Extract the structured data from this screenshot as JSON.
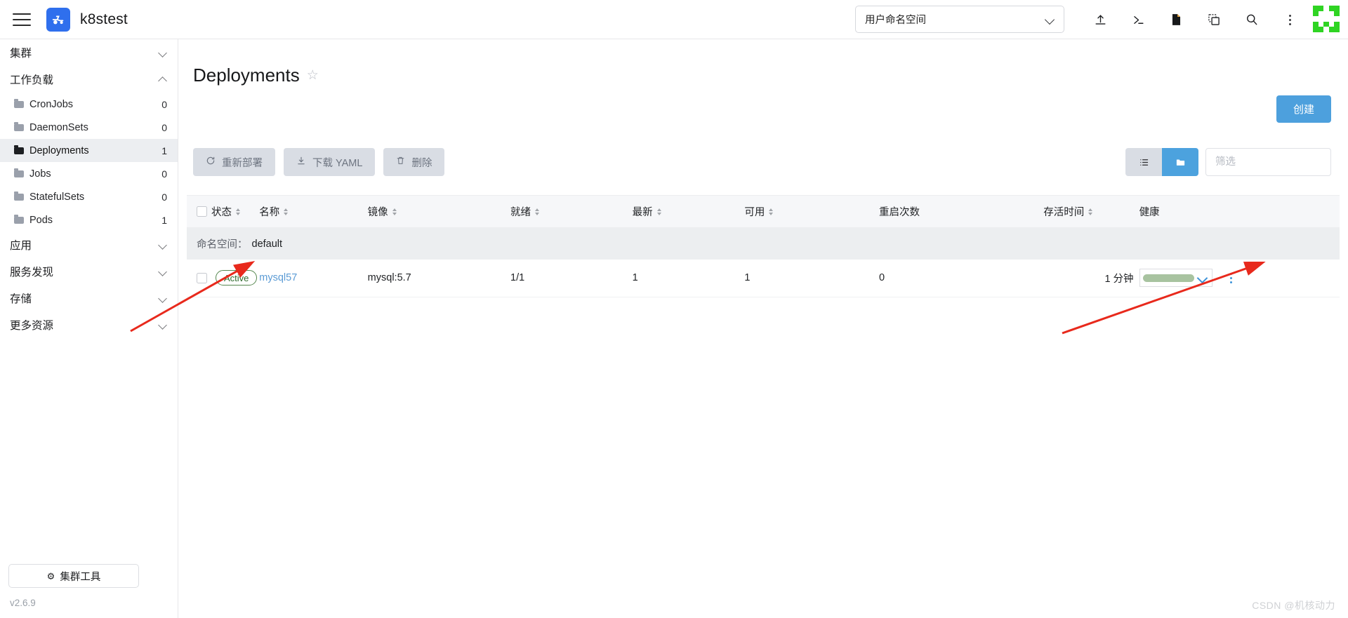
{
  "topbar": {
    "menu_icon": "hamburger-icon",
    "brand_logo_icon": "rancher-logo-icon",
    "brand_name": "k8stest",
    "namespace_selector": {
      "value": "用户命名空间",
      "chevron_icon": "chevron-down-icon"
    },
    "icons": [
      {
        "name": "import-yaml-icon",
        "glyph": "upload"
      },
      {
        "name": "kubectl-shell-icon",
        "glyph": "terminal"
      },
      {
        "name": "kubeconfig-file-icon",
        "glyph": "file"
      },
      {
        "name": "copy-kubeconfig-icon",
        "glyph": "copy"
      },
      {
        "name": "search-icon",
        "glyph": "search"
      },
      {
        "name": "more-options-icon",
        "glyph": "kebab"
      }
    ],
    "product_logo_icon": "kubernetes-green-logo",
    "product_logo_color": "#2fd423"
  },
  "sidebar": {
    "groups": [
      {
        "label": "集群",
        "expanded": false
      },
      {
        "label": "工作负载",
        "expanded": true
      },
      {
        "label": "应用",
        "expanded": false
      },
      {
        "label": "服务发现",
        "expanded": false
      },
      {
        "label": "存储",
        "expanded": false
      },
      {
        "label": "更多资源",
        "expanded": false
      }
    ],
    "workload_items": [
      {
        "label": "CronJobs",
        "count": "0",
        "active": false
      },
      {
        "label": "DaemonSets",
        "count": "0",
        "active": false
      },
      {
        "label": "Deployments",
        "count": "1",
        "active": true
      },
      {
        "label": "Jobs",
        "count": "0",
        "active": false
      },
      {
        "label": "StatefulSets",
        "count": "0",
        "active": false
      },
      {
        "label": "Pods",
        "count": "1",
        "active": false
      }
    ],
    "cluster_tools": {
      "label": "集群工具",
      "icon": "gear-icon"
    },
    "version": "v2.6.9"
  },
  "main": {
    "page_title": "Deployments",
    "favorite_icon": "star-outline-icon",
    "create_button": "创建",
    "create_button_color": "#4da0dd",
    "actions": [
      {
        "label": "重新部署",
        "icon": "refresh-icon"
      },
      {
        "label": "下载 YAML",
        "icon": "download-icon"
      },
      {
        "label": "删除",
        "icon": "trash-icon"
      }
    ],
    "view_toggle": [
      {
        "name": "flat-list-view",
        "icon": "list-icon",
        "active": false
      },
      {
        "name": "group-by-namespace-view",
        "icon": "folder-icon",
        "active": true
      }
    ],
    "filter_placeholder": "筛选",
    "filter_value": ""
  },
  "table": {
    "columns": [
      {
        "label": "状态",
        "sortable": true
      },
      {
        "label": "名称",
        "sortable": true
      },
      {
        "label": "镜像",
        "sortable": true
      },
      {
        "label": "就绪",
        "sortable": true
      },
      {
        "label": "最新",
        "sortable": true
      },
      {
        "label": "可用",
        "sortable": true
      },
      {
        "label": "重启次数",
        "sortable": false
      },
      {
        "label": "存活时间",
        "sortable": true
      },
      {
        "label": "健康",
        "sortable": false
      }
    ],
    "group_label": "命名空间：",
    "group_value": "default",
    "rows": [
      {
        "state": "Active",
        "name": "mysql57",
        "image": "mysql:5.7",
        "ready": "1/1",
        "up_to_date": "1",
        "available": "1",
        "restarts": "0",
        "age": "1 分钟",
        "health_percent": 100,
        "health_color": "#a8c3a0"
      }
    ]
  },
  "watermark": "CSDN @机核动力"
}
